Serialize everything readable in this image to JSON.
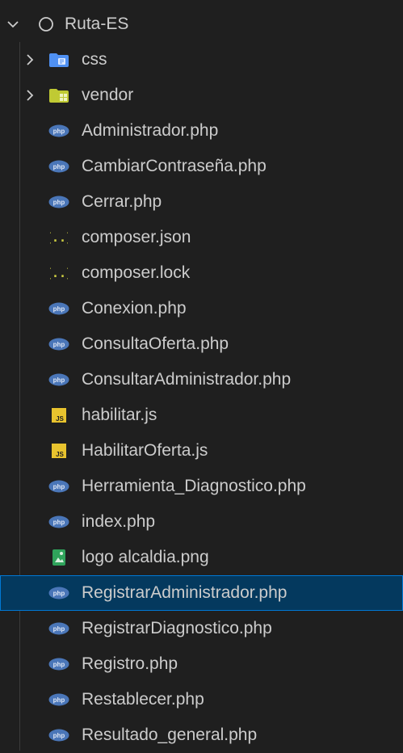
{
  "explorer": {
    "root": {
      "label": "Ruta-ES",
      "expanded": true
    },
    "items": [
      {
        "label": "css",
        "type": "folder-css",
        "icon": "css-folder-icon"
      },
      {
        "label": "vendor",
        "type": "folder-vendor",
        "icon": "vendor-folder-icon"
      },
      {
        "label": "Administrador.php",
        "type": "php",
        "icon": "php-icon"
      },
      {
        "label": "CambiarContraseña.php",
        "type": "php",
        "icon": "php-icon"
      },
      {
        "label": "Cerrar.php",
        "type": "php",
        "icon": "php-icon"
      },
      {
        "label": "composer.json",
        "type": "json",
        "icon": "json-icon"
      },
      {
        "label": "composer.lock",
        "type": "json",
        "icon": "json-icon"
      },
      {
        "label": "Conexion.php",
        "type": "php",
        "icon": "php-icon"
      },
      {
        "label": "ConsultaOferta.php",
        "type": "php",
        "icon": "php-icon"
      },
      {
        "label": "ConsultarAdministrador.php",
        "type": "php",
        "icon": "php-icon"
      },
      {
        "label": "habilitar.js",
        "type": "js",
        "icon": "js-icon"
      },
      {
        "label": "HabilitarOferta.js",
        "type": "js",
        "icon": "js-icon"
      },
      {
        "label": "Herramienta_Diagnostico.php",
        "type": "php",
        "icon": "php-icon"
      },
      {
        "label": "index.php",
        "type": "php",
        "icon": "php-icon"
      },
      {
        "label": "logo alcaldia.png",
        "type": "image",
        "icon": "image-icon"
      },
      {
        "label": "RegistrarAdministrador.php",
        "type": "php",
        "icon": "php-icon",
        "selected": true
      },
      {
        "label": "RegistrarDiagnostico.php",
        "type": "php",
        "icon": "php-icon"
      },
      {
        "label": "Registro.php",
        "type": "php",
        "icon": "php-icon"
      },
      {
        "label": "Restablecer.php",
        "type": "php",
        "icon": "php-icon"
      },
      {
        "label": "Resultado_general.php",
        "type": "php",
        "icon": "php-icon"
      }
    ]
  },
  "colors": {
    "background": "#1f1f1f",
    "text": "#cccccc",
    "selection": "#04395e",
    "selection_border": "#0078d4",
    "php": "#4a76b8",
    "json": "#cbcb41",
    "js": "#e8c32e",
    "css_folder": "#4f90f2",
    "vendor_folder": "#c0ca33"
  }
}
